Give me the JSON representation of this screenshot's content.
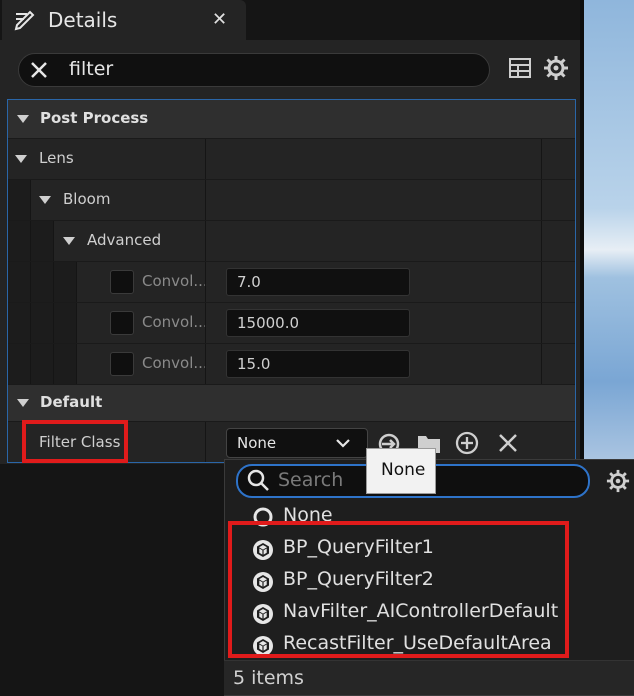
{
  "panel": {
    "title": "Details",
    "search_value": "filter"
  },
  "tree": {
    "categories": {
      "post_process": "Post Process",
      "lens": "Lens",
      "bloom": "Bloom",
      "advanced": "Advanced",
      "default": "Default"
    },
    "properties": [
      {
        "name": "Convol...",
        "value": "7.0"
      },
      {
        "name": "Convol...",
        "value": "15000.0"
      },
      {
        "name": "Convol...",
        "value": "15.0"
      }
    ],
    "filter_class": {
      "label": "Filter Class",
      "selected": "None"
    }
  },
  "popup": {
    "search_placeholder": "Search",
    "tooltip": "None",
    "items": [
      {
        "label": "None",
        "icon": "circle-icon"
      },
      {
        "label": "BP_QueryFilter1",
        "icon": "class-cube-icon"
      },
      {
        "label": "BP_QueryFilter2",
        "icon": "class-cube-icon"
      },
      {
        "label": "NavFilter_AIControllerDefault",
        "icon": "class-cube-icon"
      },
      {
        "label": "RecastFilter_UseDefaultArea",
        "icon": "class-cube-icon"
      }
    ],
    "count_label": "5 items"
  },
  "colors": {
    "highlight_box": "#e01b1b",
    "focus_blue": "#2e73c9"
  }
}
